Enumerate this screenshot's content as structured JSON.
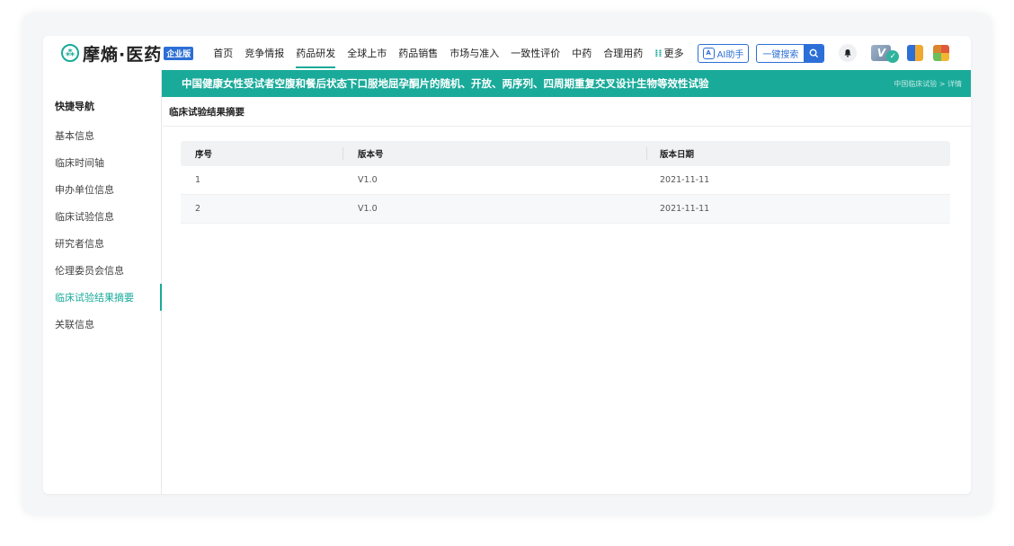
{
  "brand": {
    "logo_text": "摩熵·医药",
    "edition_badge": "企业版"
  },
  "nav": {
    "items": [
      "首页",
      "竞争情报",
      "药品研发",
      "全球上市",
      "药品销售",
      "市场与准入",
      "一致性评价",
      "中药",
      "合理用药"
    ],
    "active_index": 2,
    "more_label": "更多",
    "ai_label": "AI助手",
    "search_label": "一键搜索"
  },
  "page": {
    "title": "中国健康女性受试者空腹和餐后状态下口服地屈孕酮片的随机、开放、两序列、四周期重复交叉设计生物等效性试验",
    "breadcrumb": "中国临床试验 > 详情"
  },
  "sidebar": {
    "heading": "快捷导航",
    "items": [
      {
        "label": "基本信息"
      },
      {
        "label": "临床时间轴"
      },
      {
        "label": "申办单位信息"
      },
      {
        "label": "临床试验信息"
      },
      {
        "label": "研究者信息"
      },
      {
        "label": "伦理委员会信息"
      },
      {
        "label": "临床试验结果摘要"
      },
      {
        "label": "关联信息"
      }
    ],
    "active_index": 6
  },
  "section": {
    "title": "临床试验结果摘要"
  },
  "table": {
    "columns": [
      "序号",
      "版本号",
      "版本日期"
    ],
    "rows": [
      [
        "1",
        "V1.0",
        "2021-11-11"
      ],
      [
        "2",
        "V1.0",
        "2021-11-11"
      ]
    ]
  },
  "colors": {
    "accent": "#1aaa9a",
    "brand_blue": "#2c6fd6"
  }
}
